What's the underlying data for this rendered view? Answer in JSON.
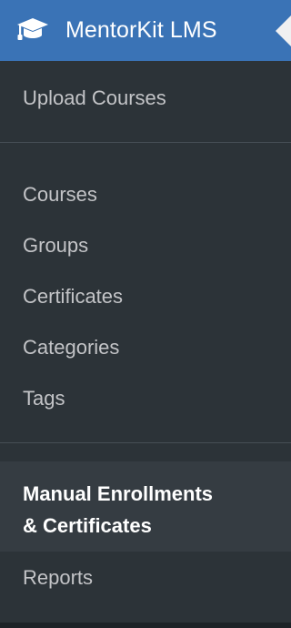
{
  "header": {
    "title": "MentorKit LMS",
    "icon": "graduation-cap-icon",
    "background": "#3a73b6"
  },
  "menu": {
    "upload": "Upload Courses",
    "items": [
      "Courses",
      "Groups",
      "Certificates",
      "Categories",
      "Tags"
    ],
    "active": {
      "line1": "Manual Enrollments",
      "line2": "& Certificates"
    },
    "reports": "Reports"
  },
  "colors": {
    "sidebar": "#2c3338",
    "text": "#c3c4c7",
    "active_text": "#ffffff",
    "active_bg": "#353c42"
  }
}
